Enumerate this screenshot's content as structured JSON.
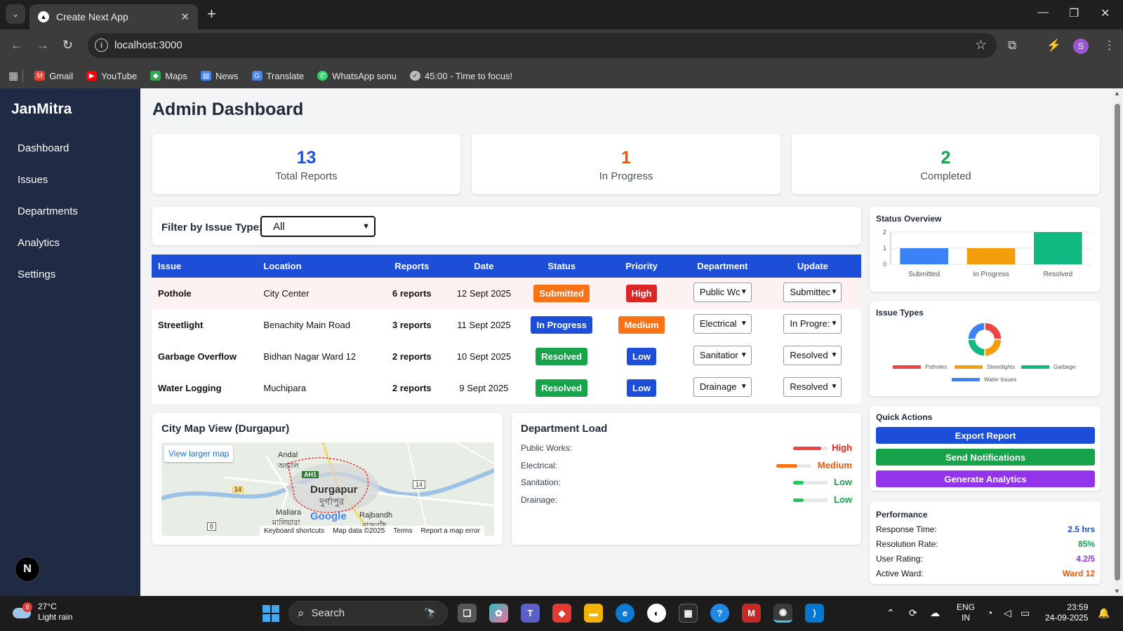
{
  "browser": {
    "tab_title": "Create Next App",
    "url": "localhost:3000",
    "profile_initial": "S",
    "bookmarks": [
      {
        "label": "Gmail",
        "icon": "gmail-icon",
        "color": "#ea4335"
      },
      {
        "label": "YouTube",
        "icon": "youtube-icon",
        "color": "#ff0000"
      },
      {
        "label": "Maps",
        "icon": "maps-icon",
        "color": "#34a853"
      },
      {
        "label": "News",
        "icon": "news-icon",
        "color": "#4285f4"
      },
      {
        "label": "Translate",
        "icon": "translate-icon",
        "color": "#4285f4"
      },
      {
        "label": "WhatsApp sonu",
        "icon": "whatsapp-icon",
        "color": "#25d366"
      },
      {
        "label": "45:00 - Time to focus!",
        "icon": "check-icon",
        "color": "#bbbbbb"
      }
    ]
  },
  "sidebar": {
    "brand": "JanMitra",
    "items": [
      {
        "label": "Dashboard"
      },
      {
        "label": "Issues"
      },
      {
        "label": "Departments"
      },
      {
        "label": "Analytics"
      },
      {
        "label": "Settings"
      }
    ],
    "badge": "N"
  },
  "dashboard": {
    "title": "Admin Dashboard",
    "stats": [
      {
        "value": "13",
        "label": "Total Reports",
        "color": "#1d4ed8"
      },
      {
        "value": "1",
        "label": "In Progress",
        "color": "#ea580c"
      },
      {
        "value": "2",
        "label": "Completed",
        "color": "#16a34a"
      }
    ],
    "filter": {
      "label": "Filter by Issue Type:",
      "value": "All"
    },
    "table": {
      "headers": [
        "Issue",
        "Location",
        "Reports",
        "Date",
        "Status",
        "Priority",
        "Department",
        "Update"
      ],
      "rows": [
        {
          "issue": "Pothole",
          "location": "City Center",
          "reports": "6 reports",
          "date": "12 Sept 2025",
          "status": "Submitted",
          "status_color": "#f97316",
          "priority": "High",
          "priority_color": "#dc2626",
          "department": "Public Wc",
          "update": "Submittec"
        },
        {
          "issue": "Streetlight",
          "location": "Benachity Main Road",
          "reports": "3 reports",
          "date": "11 Sept 2025",
          "status": "In Progress",
          "status_color": "#1d4ed8",
          "priority": "Medium",
          "priority_color": "#f97316",
          "department": "Electrical",
          "update": "In Progre:"
        },
        {
          "issue": "Garbage Overflow",
          "location": "Bidhan Nagar Ward 12",
          "reports": "2 reports",
          "date": "10 Sept 2025",
          "status": "Resolved",
          "status_color": "#16a34a",
          "priority": "Low",
          "priority_color": "#1d4ed8",
          "department": "Sanitatior",
          "update": "Resolved"
        },
        {
          "issue": "Water Logging",
          "location": "Muchipara",
          "reports": "2 reports",
          "date": "9 Sept 2025",
          "status": "Resolved",
          "status_color": "#16a34a",
          "priority": "Low",
          "priority_color": "#1d4ed8",
          "department": "Drainage",
          "update": "Resolved"
        }
      ]
    },
    "map": {
      "title": "City Map View (Durgapur)",
      "link": "View larger map",
      "labels": {
        "andal": "Andal",
        "andal_bn": "অন্ডাল",
        "durgapur": "Durgapur",
        "durgapur_bn": "দুর্গাপুর",
        "maliara": "Maliara",
        "maliara_bn": "মালিয়ারা",
        "rajbandh": "Rajbandh",
        "rajbandh_bn": "রাজবাঁধ",
        "ah1": "AH1",
        "r14a": "14",
        "r14b": "14",
        "r8": "8",
        "google": "Google"
      },
      "footer": [
        "Keyboard shortcuts",
        "Map data ©2025",
        "Terms",
        "Report a map error"
      ]
    },
    "department_load": {
      "title": "Department Load",
      "rows": [
        {
          "name": "Public Works:",
          "level": "High",
          "fraction": 0.8,
          "color": "#ef4444",
          "text_color": "#dc2626"
        },
        {
          "name": "Electrical:",
          "level": "Medium",
          "fraction": 0.6,
          "color": "#f97316",
          "text_color": "#ea580c"
        },
        {
          "name": "Sanitation:",
          "level": "Low",
          "fraction": 0.3,
          "color": "#22c55e",
          "text_color": "#16a34a"
        },
        {
          "name": "Drainage:",
          "level": "Low",
          "fraction": 0.3,
          "color": "#22c55e",
          "text_color": "#16a34a"
        }
      ]
    }
  },
  "status_overview": {
    "title": "Status Overview"
  },
  "issue_types": {
    "title": "Issue Types"
  },
  "chart_data": [
    {
      "type": "bar",
      "title": "Status Overview",
      "categories": [
        "Submitted",
        "In Progress",
        "Resolved"
      ],
      "values": [
        1,
        1,
        2
      ],
      "colors": [
        "#3b82f6",
        "#f59e0b",
        "#10b981"
      ],
      "ylim": [
        0,
        2
      ],
      "yticks": [
        "0",
        "1",
        "2"
      ],
      "grid": true
    },
    {
      "type": "pie",
      "title": "Issue Types",
      "labels": [
        "Potholes",
        "Streetlights",
        "Garbage",
        "Water Issues"
      ],
      "values": [
        1,
        1,
        1,
        1
      ],
      "colors": [
        "#ef4444",
        "#f59e0b",
        "#10b981",
        "#3b82f6"
      ],
      "legend": "bottom"
    }
  ],
  "quick_actions": {
    "title": "Quick Actions",
    "buttons": [
      {
        "label": "Export Report",
        "color": "#1d4ed8"
      },
      {
        "label": "Send Notifications",
        "color": "#16a34a"
      },
      {
        "label": "Generate Analytics",
        "color": "#9333ea"
      }
    ]
  },
  "performance": {
    "title": "Performance",
    "rows": [
      {
        "label": "Response Time:",
        "value": "2.5 hrs",
        "color": "#1d4ed8"
      },
      {
        "label": "Resolution Rate:",
        "value": "85%",
        "color": "#16a34a"
      },
      {
        "label": "User Rating:",
        "value": "4.2/5",
        "color": "#9333ea"
      },
      {
        "label": "Active Ward:",
        "value": "Ward 12",
        "color": "#ea580c"
      }
    ]
  },
  "taskbar": {
    "weather_temp": "27°C",
    "weather_desc": "Light rain",
    "weather_badge": "8",
    "search": "Search",
    "lang1": "ENG",
    "lang2": "IN",
    "time": "23:59",
    "date": "24-09-2025"
  }
}
